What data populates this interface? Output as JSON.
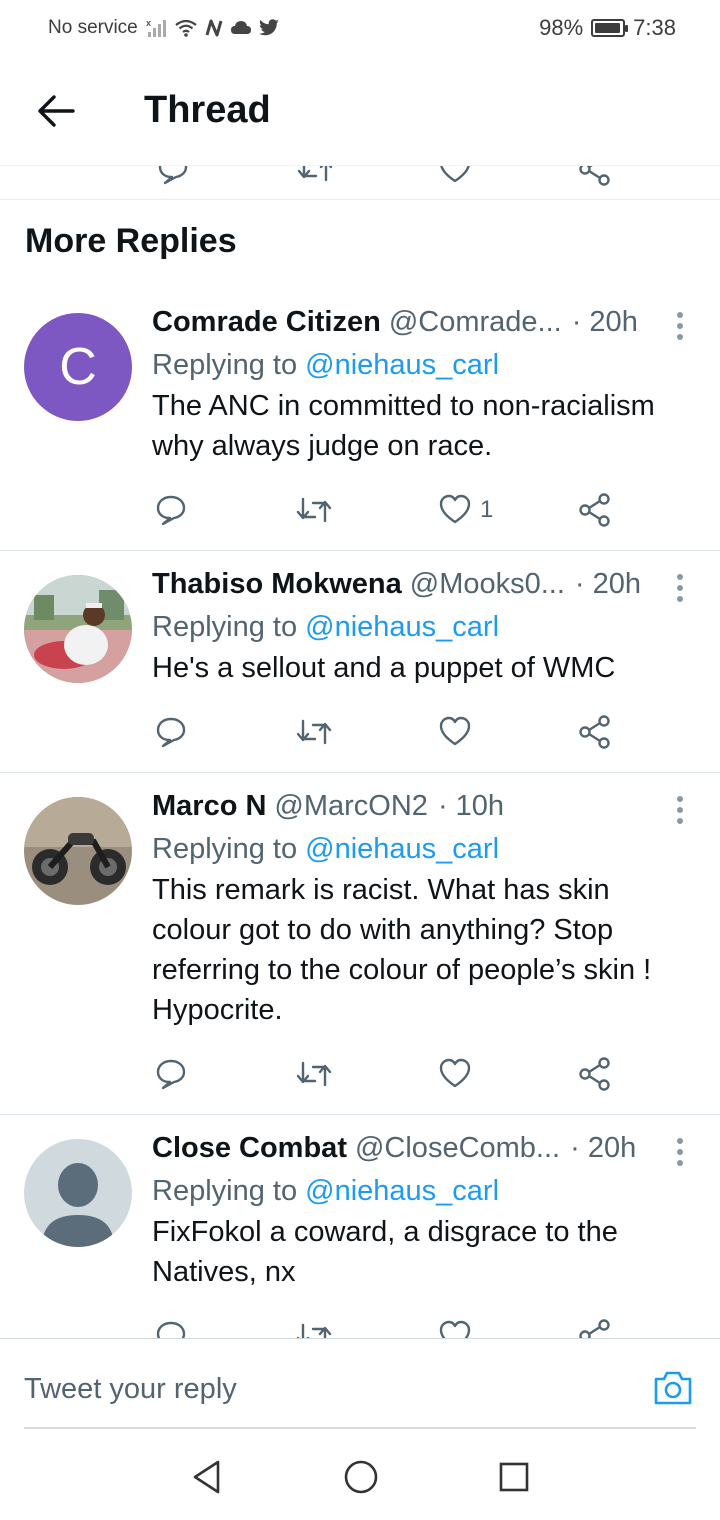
{
  "status_bar": {
    "carrier": "No service",
    "battery": "98%",
    "battery_level": 0.98,
    "time": "7:38"
  },
  "header": {
    "title": "Thread"
  },
  "section_title": "More Replies",
  "replies": [
    {
      "name": "Comrade Citizen",
      "handle": "@Comrade...",
      "time": "· 20h",
      "replying_prefix": "Replying to",
      "replying_to": "@niehaus_carl",
      "text": "The ANC in committed to non-racialism why always judge on race.",
      "likes": "1",
      "avatar_letter": "C"
    },
    {
      "name": "Thabiso Mokwena",
      "handle": "@Mooks0...",
      "time": "· 20h",
      "replying_prefix": "Replying to",
      "replying_to": "@niehaus_carl",
      "text": "He's a sellout and a puppet of WMC",
      "likes": ""
    },
    {
      "name": "Marco N",
      "handle": "@MarcON2",
      "time": "· 10h",
      "replying_prefix": "Replying to",
      "replying_to": "@niehaus_carl",
      "text": "This remark is racist. What has skin colour got to do with anything? Stop referring to the colour of people’s skin ! Hypocrite.",
      "likes": ""
    },
    {
      "name": "Close Combat",
      "handle": "@CloseComb...",
      "time": "· 20h",
      "replying_prefix": "Replying to",
      "replying_to": "@niehaus_carl",
      "text": "FixFokol a coward, a disgrace to the Natives, nx",
      "likes": ""
    }
  ],
  "reply_bar": {
    "placeholder": "Tweet your reply"
  },
  "colors": {
    "link": "#1d9bf0",
    "secondary_text": "#536471",
    "avatar_purple": "#7e58c2"
  }
}
